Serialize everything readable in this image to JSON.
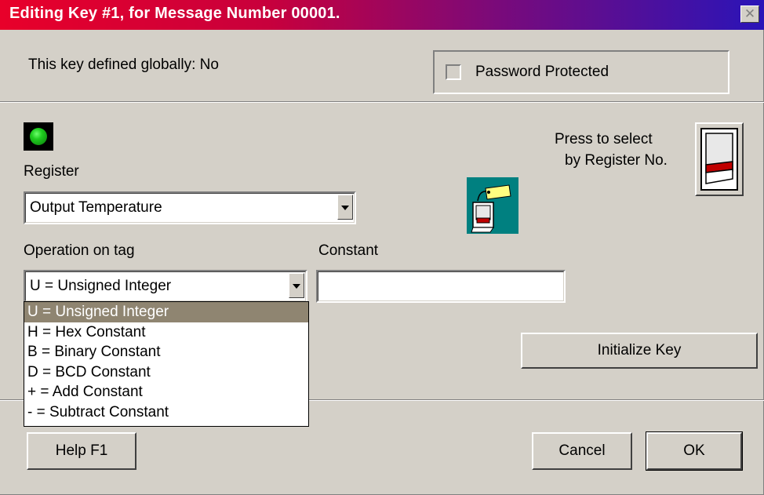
{
  "window": {
    "title": "Editing Key #1, for Message Number 00001.",
    "close_label": "✕"
  },
  "global_info": "This key defined globally:  No",
  "password": {
    "label": "Password Protected",
    "checked": false
  },
  "register": {
    "label": "Register",
    "selected": "Output Temperature",
    "select_hint_line1": "Press to select",
    "select_hint_line2": "by Register No."
  },
  "operation": {
    "label": "Operation on tag",
    "selected": "U = Unsigned Integer",
    "options": [
      "U = Unsigned Integer",
      "H = Hex Constant",
      "B = Binary Constant",
      "D = BCD Constant",
      "+ = Add Constant",
      "- = Subtract Constant"
    ]
  },
  "constant": {
    "label": "Constant",
    "value": ""
  },
  "buttons": {
    "initialize": "Initialize Key",
    "help": "Help  F1",
    "cancel": "Cancel",
    "ok": "OK"
  },
  "colors": {
    "dialog_bg": "#d4d0c8",
    "selection_bg": "#8f8571",
    "led_green": "#1fcc1f",
    "tag_icon_bg": "#008080"
  },
  "icons": [
    "led-indicator-icon",
    "tagged-key-icon",
    "switch-icon",
    "close-icon",
    "dropdown-arrow-icon"
  ]
}
